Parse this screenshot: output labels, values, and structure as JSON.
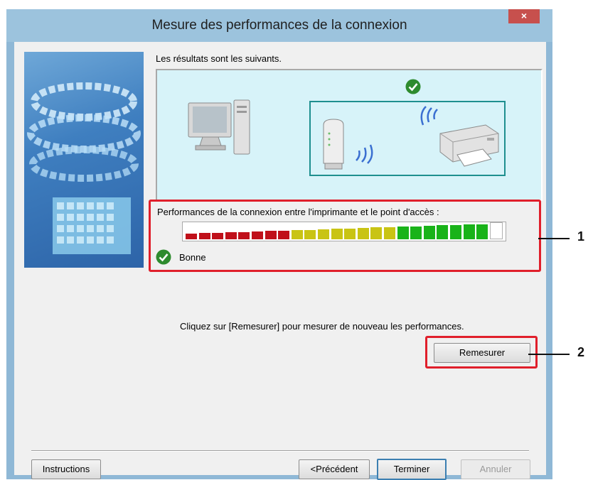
{
  "window": {
    "title": "Mesure des performances de la connexion",
    "close_label": "×"
  },
  "main": {
    "intro_text": "Les résultats sont les suivants.",
    "performance_label": "Performances de la connexion entre l'imprimante et le point d'accès :",
    "meter": {
      "level": 0.95,
      "total_segments": 24,
      "filled_segments": 23
    },
    "status_text": "Bonne",
    "hint_text": "Cliquez sur [Remesurer] pour mesurer de nouveau les performances.",
    "remeasure_label": "Remesurer"
  },
  "footer": {
    "instructions_label": "Instructions",
    "previous_label": "<Précédent",
    "finish_label": "Terminer",
    "cancel_label": "Annuler"
  },
  "callouts": [
    "1",
    "2"
  ],
  "colors": {
    "highlight": "#e01f2b",
    "ok_green": "#2e8b2e",
    "meter_red": "#c0101a",
    "meter_yellow": "#c9c414",
    "meter_green": "#19b319"
  },
  "icons": [
    "computer-icon",
    "access-point-icon",
    "printer-icon",
    "wifi-wave-icon",
    "check-icon"
  ]
}
